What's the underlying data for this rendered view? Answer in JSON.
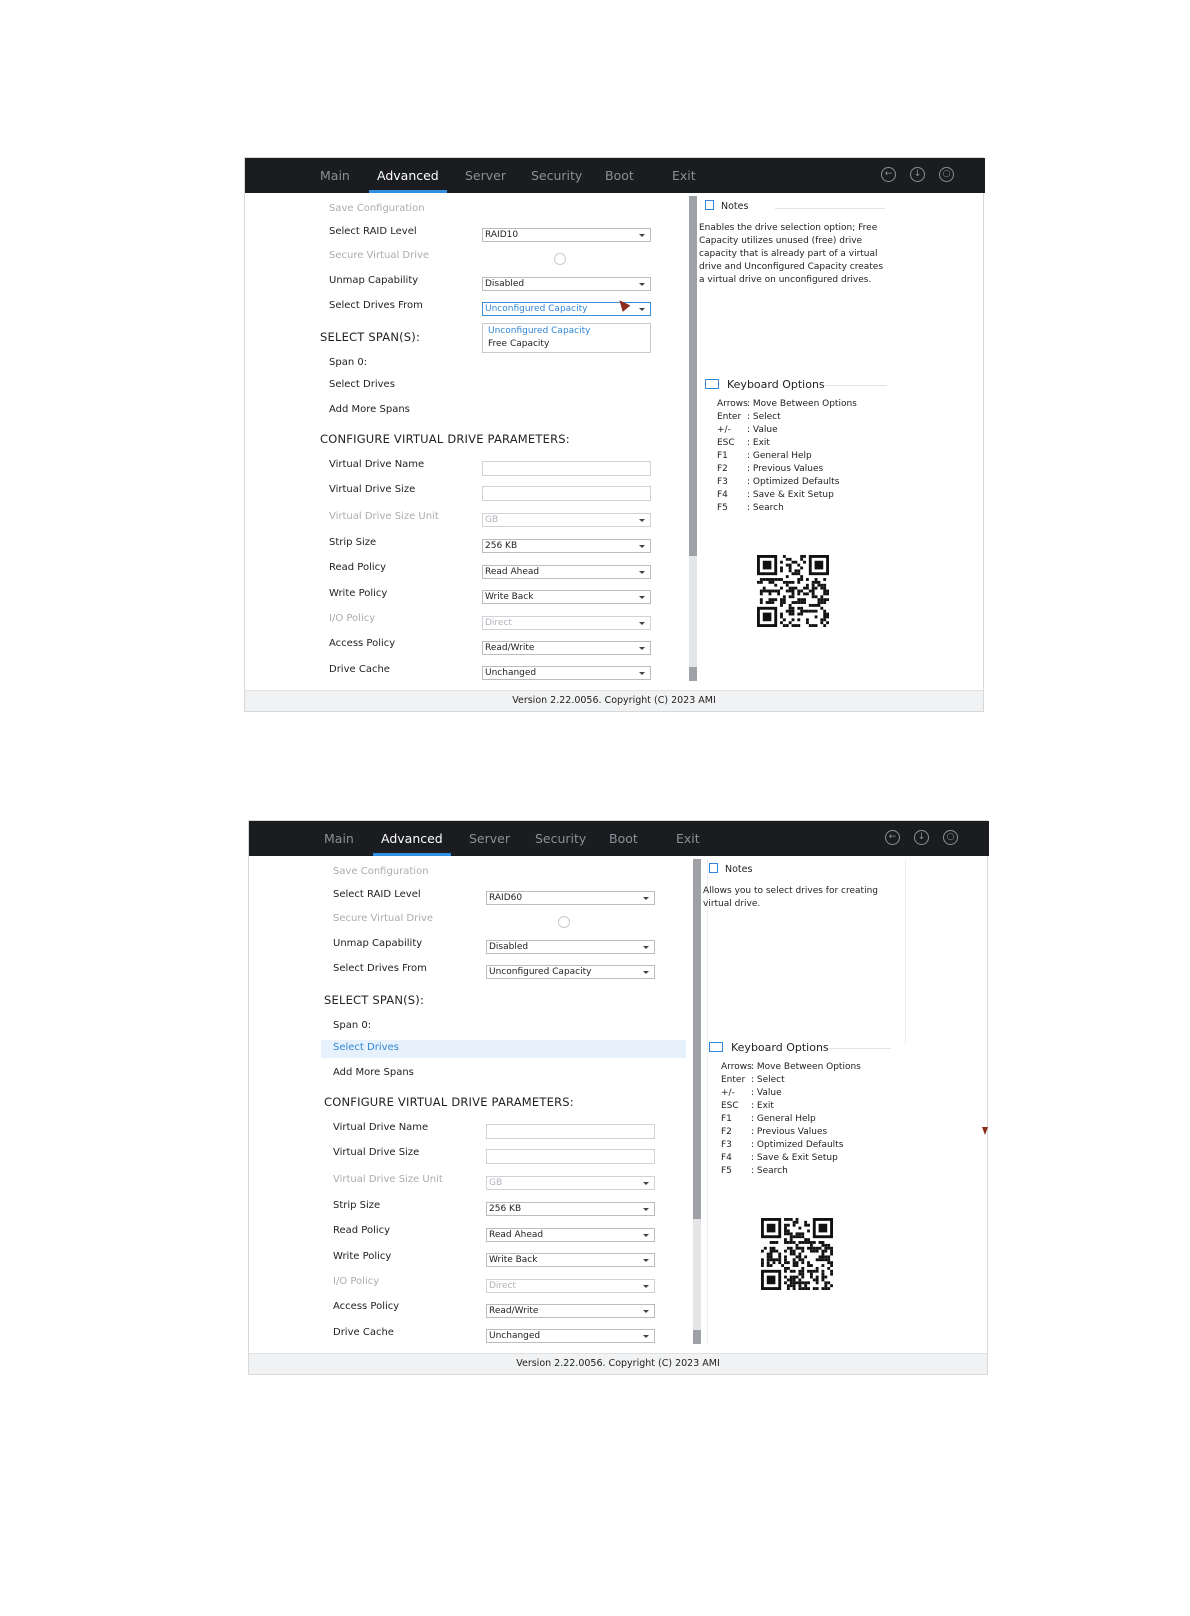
{
  "tabs": [
    "Main",
    "Advanced",
    "Server",
    "Security",
    "Boot",
    "Exit"
  ],
  "icons": [
    "back-icon",
    "save-icon",
    "search-icon"
  ],
  "footer": "Version 2.22.0056. Copyright (C) 2023 AMI",
  "notes_title": "Notes",
  "keyboard": {
    "title": "Keyboard Options",
    "rows": [
      {
        "key": "Arrows",
        "desc": ": Move Between Options"
      },
      {
        "key": "Enter",
        "desc": ": Select"
      },
      {
        "key": "+/-",
        "desc": ": Value"
      },
      {
        "key": "ESC",
        "desc": ": Exit"
      },
      {
        "key": "F1",
        "desc": ": General Help"
      },
      {
        "key": "F2",
        "desc": ": Previous Values"
      },
      {
        "key": "F3",
        "desc": ": Optimized Defaults"
      },
      {
        "key": "F4",
        "desc": ": Save & Exit Setup"
      },
      {
        "key": "F5",
        "desc": ": Search"
      }
    ]
  },
  "labels": {
    "save_configuration": "Save Configuration",
    "select_raid_level": "Select RAID Level",
    "secure_virtual_drive": "Secure Virtual Drive",
    "unmap_capability": "Unmap Capability",
    "select_drives_from": "Select Drives From",
    "select_spans": "SELECT SPAN(S):",
    "span0": "Span 0:",
    "select_drives": "Select Drives",
    "add_more_spans": "Add More Spans",
    "configure_params": "CONFIGURE VIRTUAL DRIVE PARAMETERS:",
    "virtual_drive_name": "Virtual Drive Name",
    "virtual_drive_size": "Virtual Drive Size",
    "virtual_drive_size_unit": "Virtual Drive Size Unit",
    "strip_size": "Strip Size",
    "read_policy": "Read Policy",
    "write_policy": "Write Policy",
    "io_policy": "I/O Policy",
    "access_policy": "Access Policy",
    "drive_cache": "Drive Cache"
  },
  "values": {
    "unmap": "Disabled",
    "size_unit": "GB",
    "strip": "256 KB",
    "read": "Read Ahead",
    "write": "Write Back",
    "io": "Direct",
    "access": "Read/Write",
    "cache": "Unchanged"
  },
  "screen1": {
    "raid_level": "RAID10",
    "drives_from": "Unconfigured Capacity",
    "dropdown_options": [
      "Unconfigured Capacity",
      "Free Capacity"
    ],
    "notes_text": "Enables the drive selection option; Free Capacity utilizes unused (free) drive capacity that is already part of a virtual drive and Unconfigured Capacity creates a virtual drive on unconfigured drives."
  },
  "screen2": {
    "raid_level": "RAID60",
    "drives_from": "Unconfigured Capacity",
    "notes_text": "Allows you to select drives for creating virtual drive."
  }
}
